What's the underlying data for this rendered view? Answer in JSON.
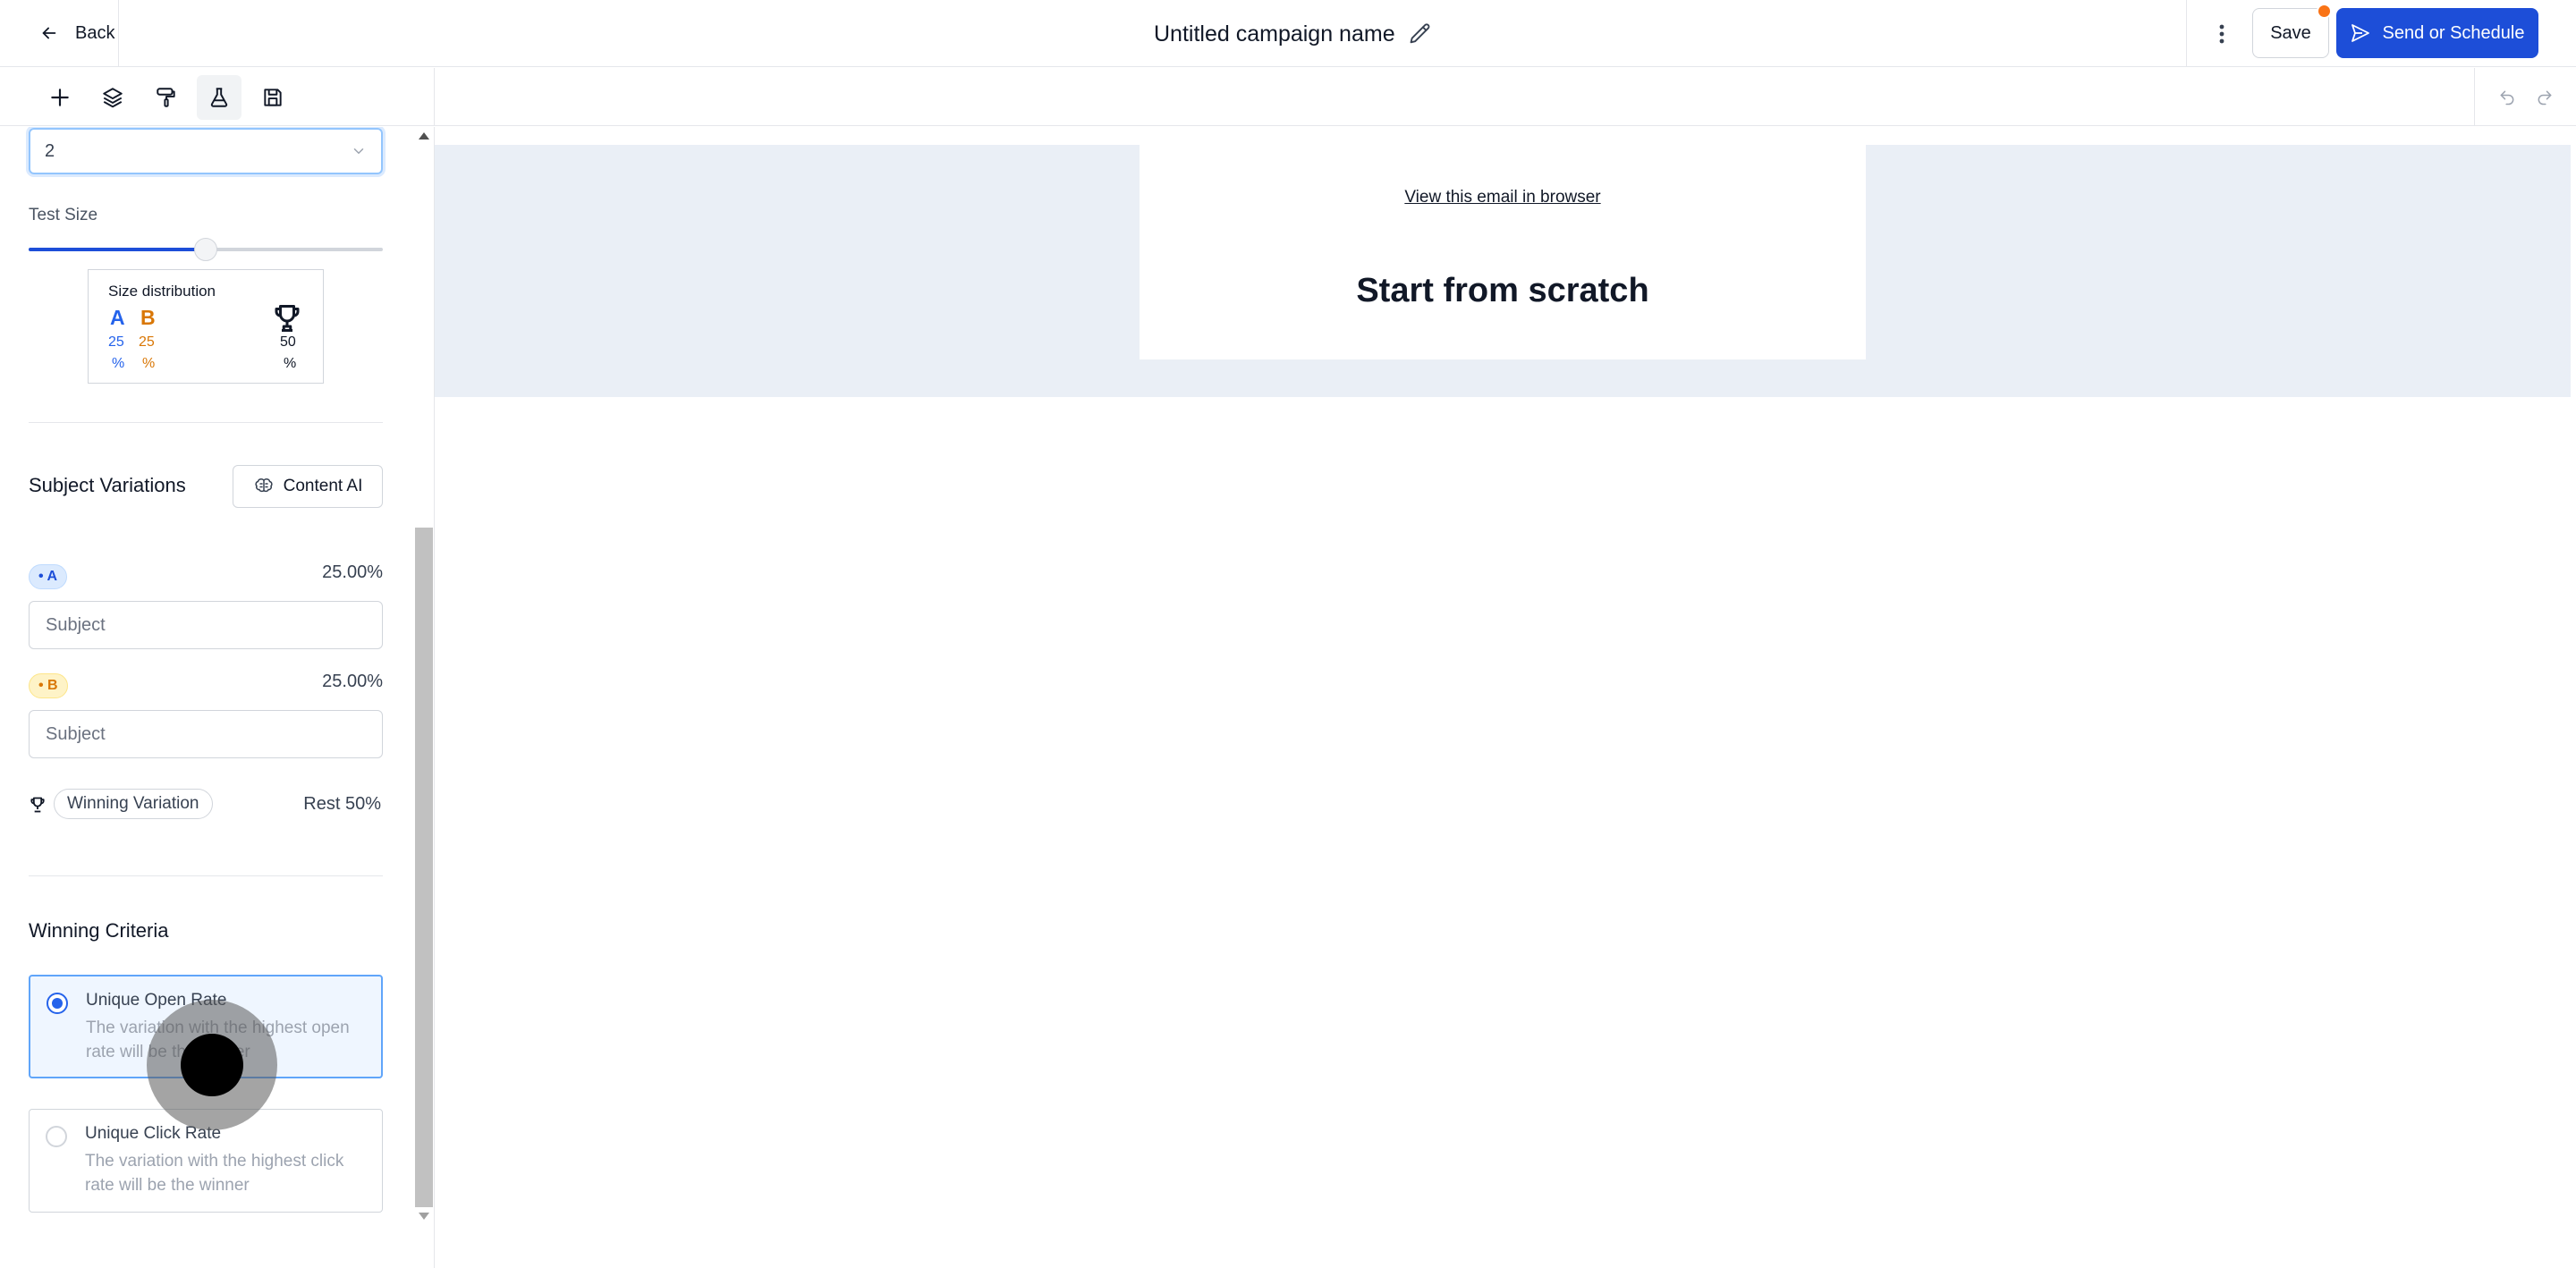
{
  "header": {
    "back_label": "Back",
    "campaign_title": "Untitled campaign name",
    "save_label": "Save",
    "send_label": "Send or Schedule"
  },
  "toolbar": {
    "tools": [
      "add-icon",
      "layers-icon",
      "paint-roller-icon",
      "flask-icon",
      "save-template-icon"
    ],
    "active_tool": "flask-icon"
  },
  "ab_test": {
    "variations_count": "2",
    "test_size_label": "Test Size",
    "test_size_value": 0.5,
    "distribution": {
      "title": "Size distribution",
      "a_letter": "A",
      "b_letter": "B",
      "a_value": "25",
      "b_value": "25",
      "winner_value": "50",
      "pct": "%"
    }
  },
  "subject_variations": {
    "title": "Subject Variations",
    "content_ai_label": "Content AI",
    "variants": [
      {
        "badge": "• A",
        "percent": "25.00%",
        "placeholder": "Subject"
      },
      {
        "badge": "• B",
        "percent": "25.00%",
        "placeholder": "Subject"
      }
    ],
    "winning_label": "Winning Variation",
    "winning_rest": "Rest 50%"
  },
  "winning_criteria": {
    "title": "Winning Criteria",
    "options": [
      {
        "title": "Unique Open Rate",
        "description": "The variation with the highest open rate will be the winner",
        "selected": true
      },
      {
        "title": "Unique Click Rate",
        "description": "The variation with the highest click rate will be the winner",
        "selected": false
      }
    ]
  },
  "email_preview": {
    "view_link": "View this email in browser",
    "heading": "Start from scratch"
  },
  "colors": {
    "primary": "#1d4ed8",
    "variant_a": "#2563eb",
    "variant_b": "#d97706",
    "notification_dot": "#f97316",
    "canvas_bg": "#eaeff6"
  }
}
